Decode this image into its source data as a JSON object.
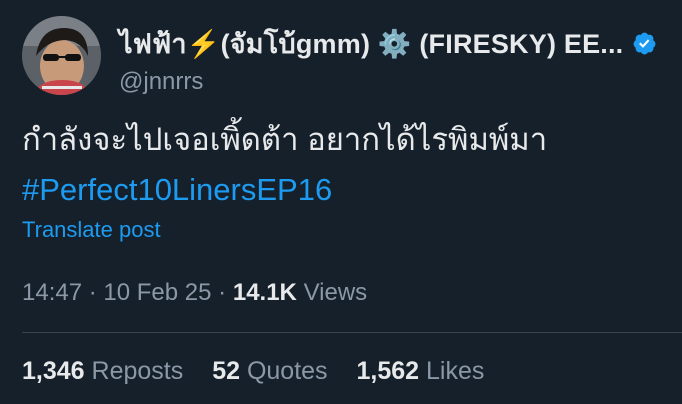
{
  "author": {
    "display_name": "ไฟฟ้า⚡️(จัมโบ้gmm) ⚙️ (FIRESKY) EE...",
    "handle": "@jnnrrs",
    "verified": true
  },
  "post": {
    "text": "กำลังจะไปเจอเพิ้ดต้า อยากได้ไรพิมพ์มา",
    "hashtag": "#Perfect10LinersEP16",
    "translate_label": "Translate post"
  },
  "meta": {
    "time": "14:47",
    "date": "10 Feb 25",
    "views_count": "14.1K",
    "views_label": "Views",
    "separator": "·"
  },
  "stats": {
    "reposts_count": "1,346",
    "reposts_label": "Reposts",
    "quotes_count": "52",
    "quotes_label": "Quotes",
    "likes_count": "1,562",
    "likes_label": "Likes"
  },
  "colors": {
    "background": "#15202b",
    "text_primary": "#e7e9ea",
    "text_secondary": "#8b98a5",
    "accent": "#1d9bf0",
    "divider": "#38444d"
  },
  "icons": {
    "verified": "verified-badge-icon"
  }
}
